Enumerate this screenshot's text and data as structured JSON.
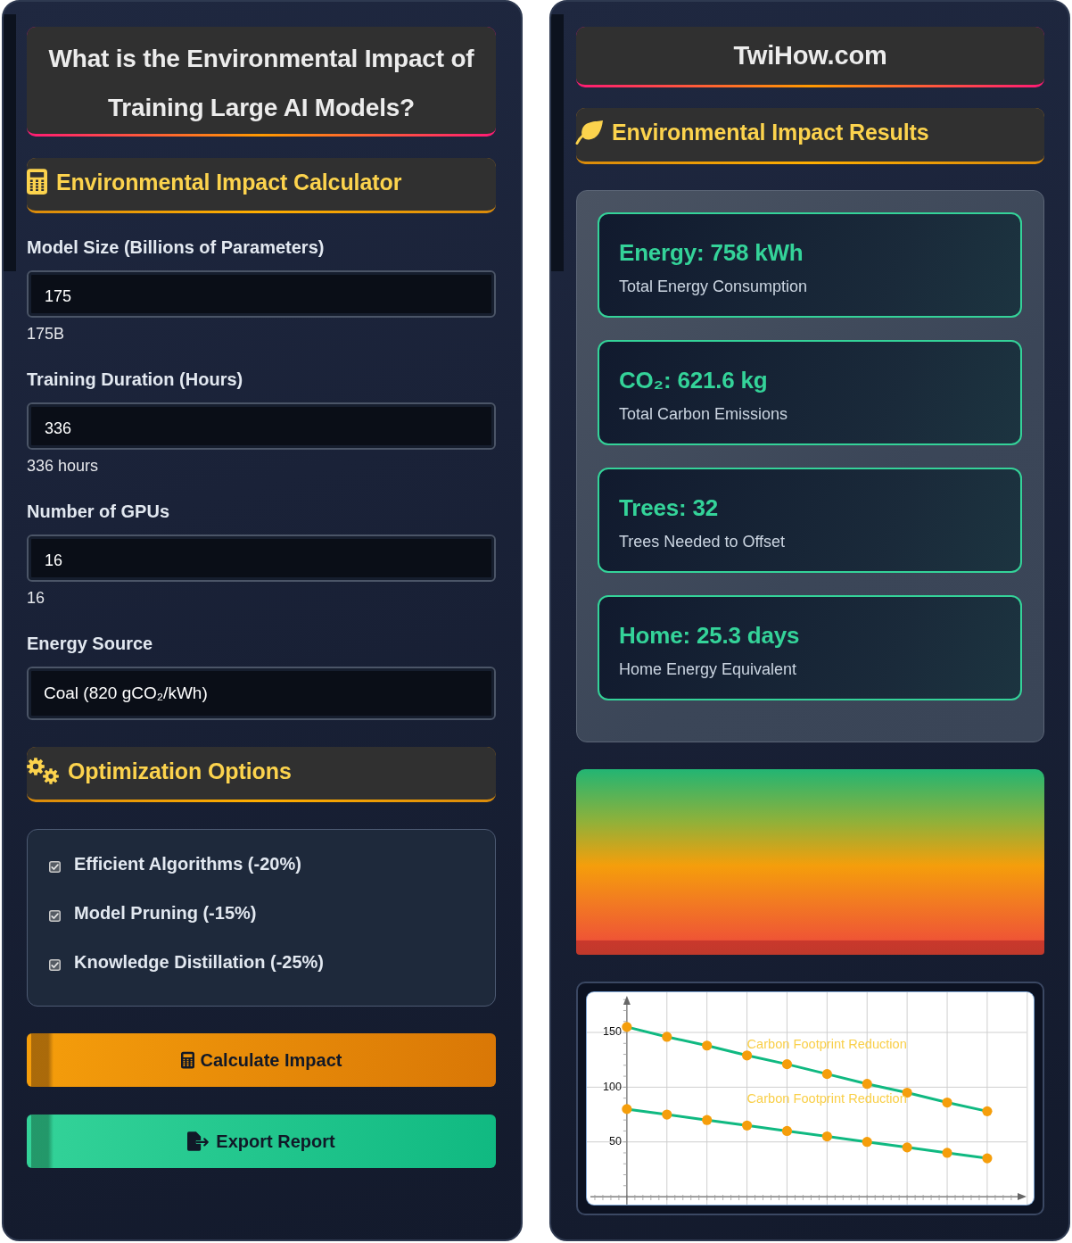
{
  "calculator": {
    "title": "What is the Environmental Impact of Training Large AI Models?",
    "heading": "Environmental Impact Calculator",
    "fields": [
      {
        "kind": "number",
        "label": "Model Size (Billions of Parameters)",
        "value": "175",
        "readout": "175B"
      },
      {
        "kind": "number",
        "label": "Training Duration (Hours)",
        "value": "336",
        "readout": "336 hours"
      },
      {
        "kind": "number",
        "label": "Number of GPUs",
        "value": "16",
        "readout": "16"
      },
      {
        "kind": "select",
        "label": "Energy Source",
        "value": "Coal (820 gCO₂/kWh)"
      }
    ],
    "optimization": {
      "heading": "Optimization Options",
      "options": [
        {
          "label": "Efficient Algorithms (-20%)",
          "checked": true
        },
        {
          "label": "Model Pruning (-15%)",
          "checked": true
        },
        {
          "label": "Knowledge Distillation (-25%)",
          "checked": true
        }
      ]
    },
    "buttons": [
      {
        "kind": "calculate",
        "label": "Calculate Impact"
      },
      {
        "kind": "export",
        "label": "Export Report"
      }
    ]
  },
  "results": {
    "site_title": "TwiHow.com",
    "heading": "Environmental Impact Results",
    "metrics": [
      {
        "value": "Energy: 758 kWh",
        "caption": "Total Energy Consumption"
      },
      {
        "value": "CO₂: 621.6 kg",
        "caption": "Total Carbon Emissions"
      },
      {
        "value": "Trees: 32",
        "caption": "Trees Needed to Offset"
      },
      {
        "value": "Home: 25.3 days",
        "caption": "Home Energy Equivalent"
      }
    ],
    "chart": {
      "chart_data": {
        "type": "line",
        "categories": [
          null,
          null,
          null,
          null,
          null,
          null,
          null,
          null,
          null,
          null
        ],
        "series": [
          {
            "color": "#10b981",
            "marker": "circle",
            "values": [
              155,
              146,
              138,
              129,
              121,
              112,
              103,
              95,
              86,
              78
            ]
          },
          {
            "color": "#10b981",
            "marker": "circle",
            "values": [
              80,
              75,
              70,
              65,
              60,
              55,
              50,
              45,
              40,
              35
            ]
          }
        ],
        "ylim": [
          -7.3,
          186.7
        ],
        "yticks": [
          50,
          100,
          150
        ],
        "grid": true,
        "annotations": [
          {
            "text": "Carbon Footprint Reduction"
          },
          {
            "text": "Carbon Footprint Reduction"
          }
        ]
      }
    }
  }
}
